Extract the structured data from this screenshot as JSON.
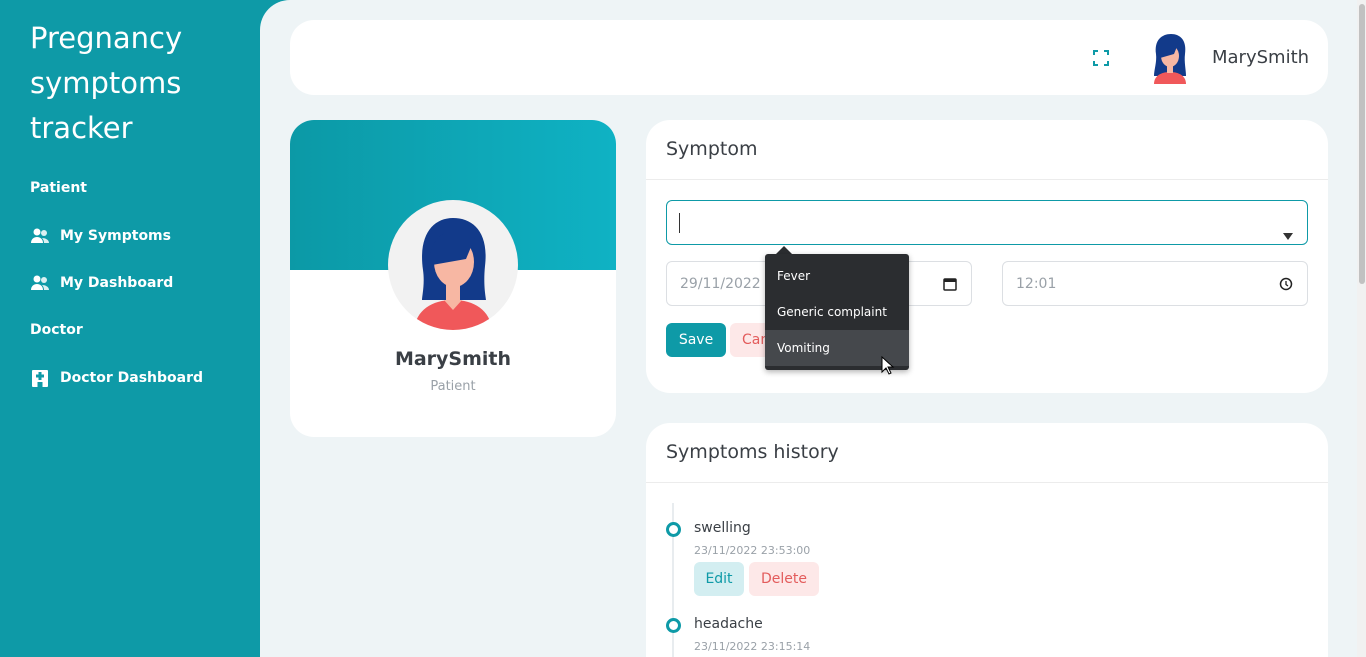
{
  "app": {
    "title": "Pregnancy symptoms tracker"
  },
  "sidebar": {
    "sections": [
      {
        "heading": "Patient",
        "items": [
          {
            "label": "My Symptoms",
            "icon": "users-icon"
          },
          {
            "label": "My Dashboard",
            "icon": "users-icon"
          }
        ]
      },
      {
        "heading": "Doctor",
        "items": [
          {
            "label": "Doctor Dashboard",
            "icon": "hospital-icon"
          }
        ]
      }
    ]
  },
  "header": {
    "username": "MarySmith",
    "fullscreen_icon": "fullscreen-icon"
  },
  "profile": {
    "name": "MarySmith",
    "role": "Patient"
  },
  "symptom_form": {
    "title": "Symptom",
    "symptom_value": "",
    "date_value": "29/11/2022",
    "time_value": "12:01",
    "save_label": "Save",
    "cancel_label": "Cancel",
    "dropdown_options": [
      "Fever",
      "Generic complaint",
      "Vomiting"
    ],
    "hovered_option": "Vomiting"
  },
  "history": {
    "title": "Symptoms history",
    "items": [
      {
        "name": "swelling",
        "datetime": "23/11/2022 23:53:00",
        "edit_label": "Edit",
        "delete_label": "Delete"
      },
      {
        "name": "headache",
        "datetime": "23/11/2022 23:15:14"
      }
    ]
  },
  "colors": {
    "accent": "#0e9aa7",
    "danger": "#e35c5c",
    "background": "#eef4f6"
  }
}
